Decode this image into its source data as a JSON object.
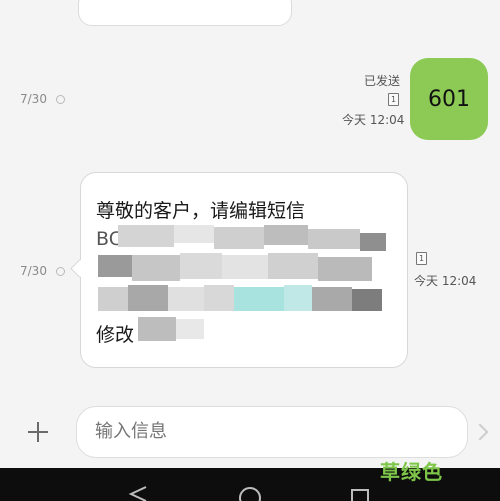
{
  "conversation": {
    "messages": [
      {
        "direction": "sent",
        "date": "7/30",
        "text": "601",
        "status": "已发送",
        "time": "今天 12:04",
        "sim": "1"
      },
      {
        "direction": "received",
        "date": "7/30",
        "text_visible": [
          "尊敬的客户，请编辑短信",
          "BC",
          "修改"
        ],
        "time": "今天 12:04",
        "sim": "1"
      }
    ]
  },
  "composer": {
    "add_icon": "plus-icon",
    "placeholder": "输入信息",
    "send_icon": "chevron-right-icon"
  },
  "navigation": {
    "icons": [
      "back-triangle-icon",
      "home-circle-icon",
      "recents-square-icon"
    ]
  },
  "watermark": "草绿色",
  "colors": {
    "sent_bubble": "#8cca55",
    "background": "#f4f4f4",
    "received_bubble": "#ffffff",
    "nav_bar": "#0d0d0d",
    "watermark": "#7ec64a"
  }
}
